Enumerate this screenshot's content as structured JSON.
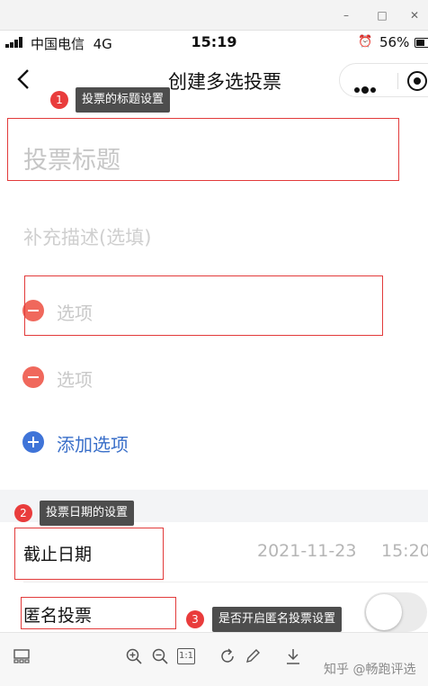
{
  "window": {
    "minimize": "–",
    "maximize": "□",
    "close": "✕"
  },
  "status_bar": {
    "carrier": "中国电信",
    "network": "4G",
    "time": "15:19",
    "battery": "56%",
    "battery_level": 0.56
  },
  "nav": {
    "title": "创建多选投票"
  },
  "form": {
    "title_placeholder": "投票标题",
    "description_placeholder": "补充描述(选填)",
    "options": [
      "选项",
      "选项"
    ],
    "add_option": "添加选项"
  },
  "settings": {
    "deadline_label": "截止日期",
    "deadline_date": "2021-11-23",
    "deadline_time": "15:20",
    "anonymous_label": "匿名投票",
    "anonymous_enabled": false
  },
  "annotations": [
    {
      "number": "1",
      "text": "投票的标题设置"
    },
    {
      "number": "2",
      "text": "投票日期的设置"
    },
    {
      "number": "3",
      "text": "是否开启匿名投票设置"
    }
  ],
  "viewer_toolbar": {
    "actual_size": "1:1"
  },
  "watermark": "知乎 @畅跑评选",
  "colors": {
    "remove": "#f0685c",
    "add": "#3f74d8",
    "annotation_box": "#e23b3b",
    "annotation_badge": "#e93c3c"
  }
}
